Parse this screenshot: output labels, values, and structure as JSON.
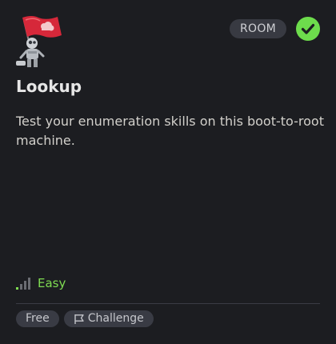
{
  "room": {
    "title": "Lookup",
    "type_badge": "ROOM",
    "completed": true,
    "thumbnail_icon": "robot-with-flag-icon",
    "description": "Test your enumeration skills on this boot-to-root machine.",
    "difficulty": {
      "label": "Easy",
      "level": 1,
      "max_level": 4,
      "icon": "signal-bars-icon",
      "color": "#7fdc52"
    },
    "tags": [
      {
        "label": "Free",
        "icon": ""
      },
      {
        "label": "Challenge",
        "icon": "flag-outline-icon"
      }
    ]
  },
  "colors": {
    "background": "#1c1d21",
    "completed_check": "#6ddc4c",
    "badge_bg": "#383a42",
    "flag_red": "#d6283a"
  }
}
